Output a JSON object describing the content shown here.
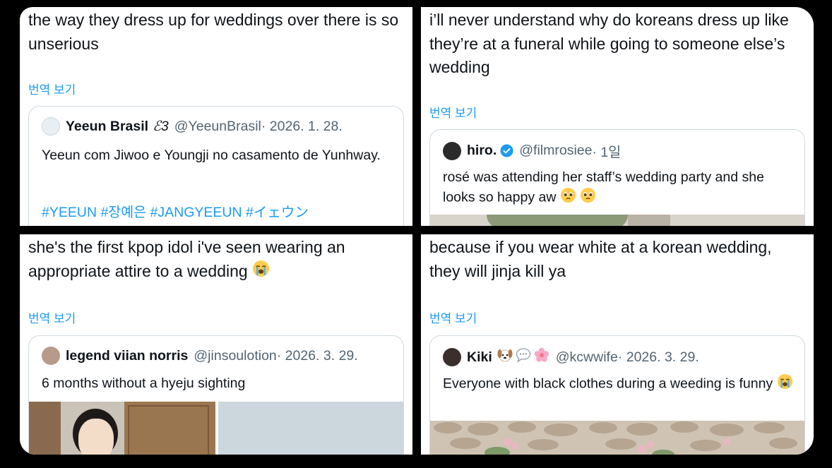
{
  "posts": [
    {
      "text": "the way they dress up for weddings over there is so unserious",
      "translate_label": "번역 보기",
      "quote": {
        "name": "Yeeun Brasil",
        "name_suffix": "ℰ3",
        "handle": "@YeeunBrasil",
        "time": "· 2026. 1. 28.",
        "text": "Yeeun com Jiwoo e Youngji no casamento de Yunhway.",
        "hashtags": "#YEEUN #장예은 #JANGYEEUN #イェウン"
      }
    },
    {
      "text": "i’ll never understand why do koreans dress up like they’re at a funeral while going to someone else’s wedding",
      "translate_label": "번역 보기",
      "quote": {
        "name": "hiro.",
        "handle": "@filmrosiee",
        "time": "· 1일",
        "text": "rosé was attending her staff’s wedding party and she looks so happy aw"
      }
    },
    {
      "text": "she's the first kpop idol i've seen wearing an appropriate attire to a wedding",
      "translate_label": "번역 보기",
      "quote": {
        "name": "legend viian norris",
        "handle": "@jinsoulotion",
        "time": "· 2026. 3. 29.",
        "text": "6 months without a hyeju sighting"
      }
    },
    {
      "text": "because if you wear white at a korean wedding, they will jinja kill ya",
      "translate_label": "번역 보기",
      "quote": {
        "name": "Kiki",
        "handle": "@kcwwife",
        "time": "· 2026. 3. 29.",
        "text": "Everyone with black clothes during a weeding is funny"
      }
    }
  ],
  "colors": {
    "link": "#1d9bf0",
    "text": "#0f1419",
    "muted": "#536471",
    "border": "#cfd9de",
    "verified": "#1d9bf0"
  },
  "icons": [
    "verified-badge-icon",
    "pleading-face-emoji-icon",
    "loudly-crying-face-emoji-icon",
    "dog-face-emoji-icon",
    "speech-bubble-emoji-icon",
    "cherry-blossom-emoji-icon"
  ]
}
